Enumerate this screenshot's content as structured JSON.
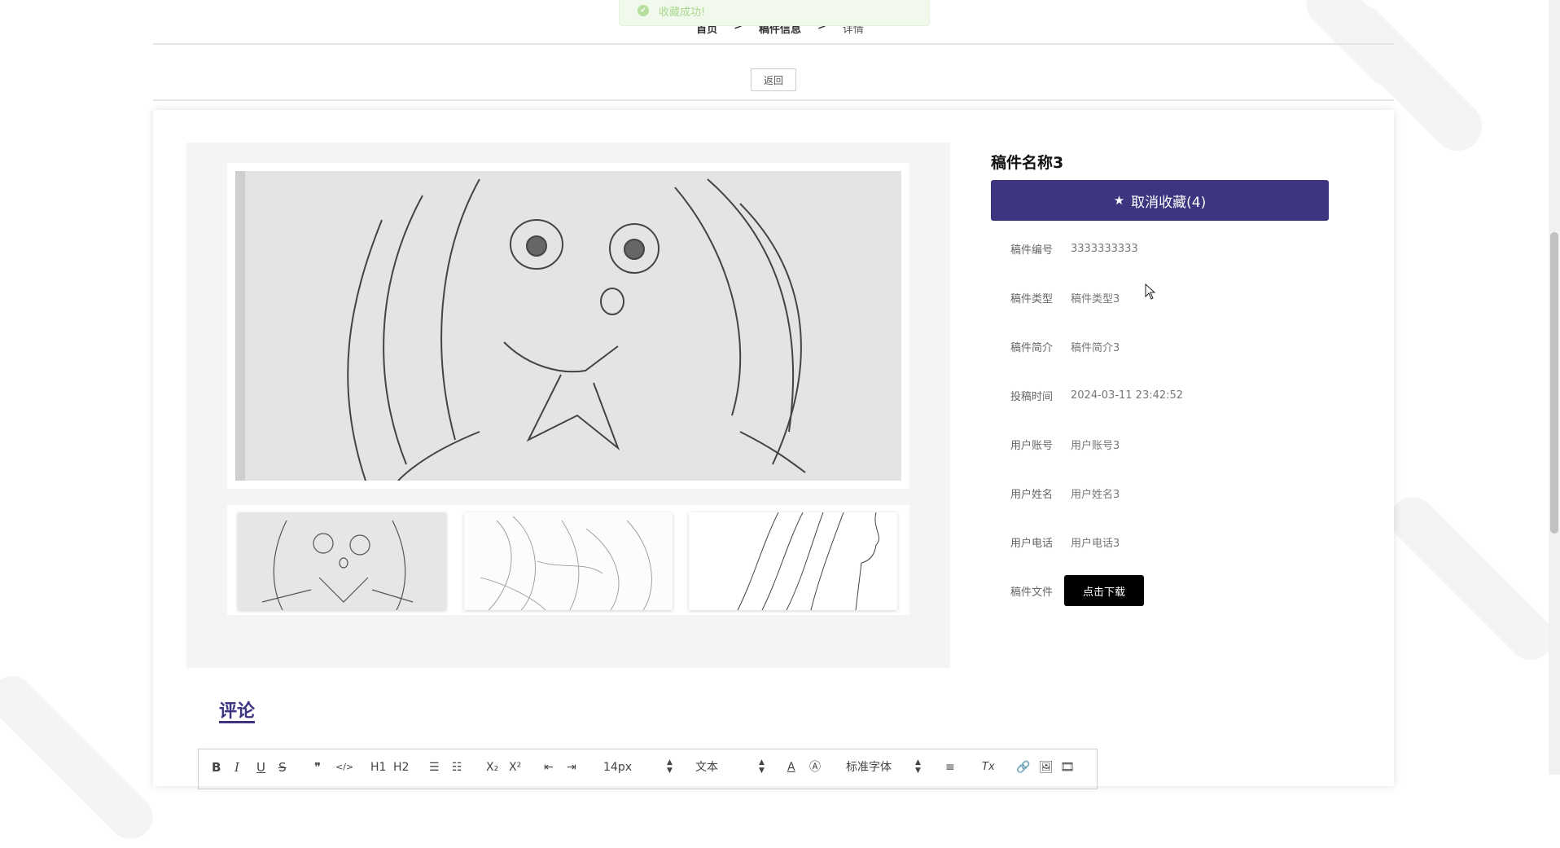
{
  "toast": {
    "icon": "check-circle-icon",
    "message": "收藏成功!"
  },
  "breadcrumb": {
    "home": "首页",
    "section": "稿件信息",
    "current": "详情",
    "separator": ">"
  },
  "back_button": "返回",
  "detail": {
    "title": "稿件名称3",
    "favorite_button": "取消收藏(4)",
    "favorite_icon": "star-icon",
    "fields": [
      {
        "label": "稿件编号",
        "value": "3333333333"
      },
      {
        "label": "稿件类型",
        "value": "稿件类型3"
      },
      {
        "label": "稿件简介",
        "value": "稿件简介3"
      },
      {
        "label": "投稿时间",
        "value": "2024-03-11 23:42:52"
      },
      {
        "label": "用户账号",
        "value": "用户账号3"
      },
      {
        "label": "用户姓名",
        "value": "用户姓名3"
      },
      {
        "label": "用户电话",
        "value": "用户电话3"
      }
    ],
    "file_label": "稿件文件",
    "download_button": "点击下载"
  },
  "gallery": {
    "main_image": "anime-girl-sketch",
    "thumbnails": [
      "anime-girl-sketch",
      "line-art-couple",
      "line-art-profile"
    ]
  },
  "comments": {
    "title": "评论"
  },
  "editor_toolbar": {
    "bold": "B",
    "italic": "I",
    "underline": "U",
    "strike": "S",
    "quote": "❞",
    "code": "</>",
    "h1": "H1",
    "h2": "H2",
    "subscript": "X₂",
    "superscript": "X²",
    "font_size": "14px",
    "text_type": "文本",
    "font_family": "标准字体",
    "clear_format": "Tx"
  },
  "colors": {
    "accent": "#3d3580",
    "toast_bg": "#f0f9eb",
    "download_bg": "#000000"
  }
}
